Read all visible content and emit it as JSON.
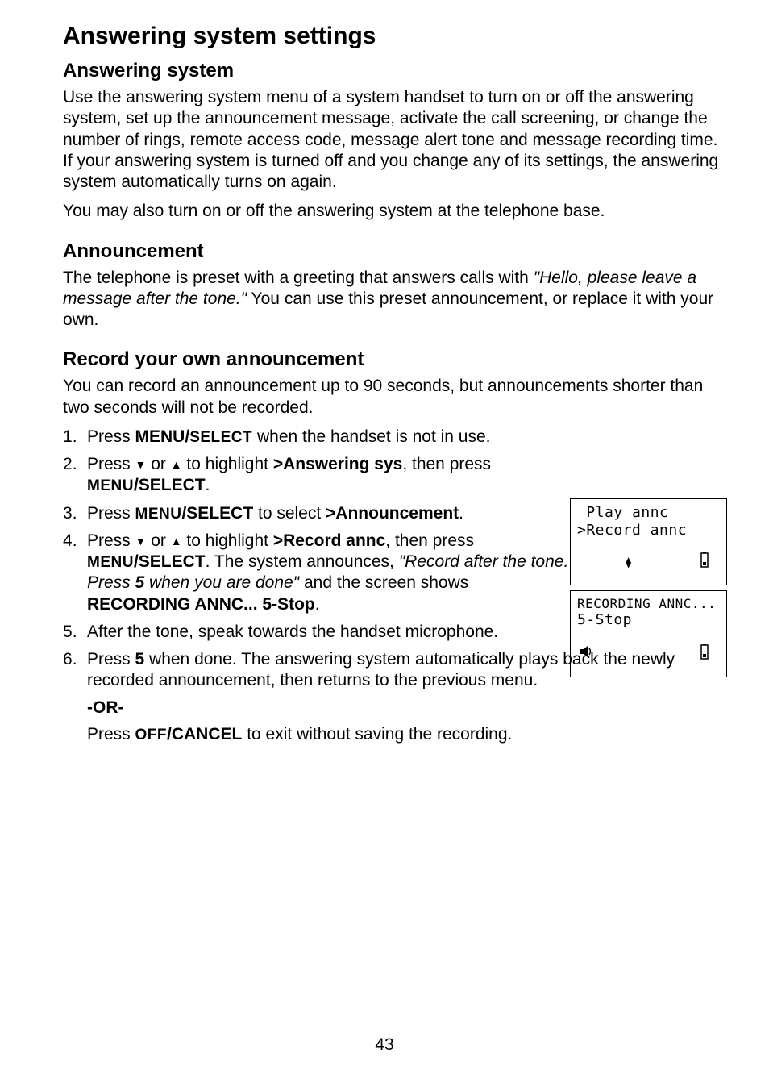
{
  "page_title": "Answering system settings",
  "page_number": "43",
  "section1": {
    "heading": "Answering system",
    "p1": "Use the answering system menu of a system handset to turn on or off the answering system, set up the announcement message, activate the call screening, or change the number of rings, remote access code, message alert tone and message recording time. If your answering system is turned off and you change any of its settings, the answering system automatically turns on again.",
    "p2": "You may also turn on or off the answering system at the telephone base."
  },
  "section2": {
    "heading": "Announcement",
    "pre": "The telephone is preset with a greeting that answers calls with ",
    "ital": "\"Hello, please leave a message after the tone.\"",
    "post": " You can use this preset announcement, or replace it with your own."
  },
  "section3": {
    "heading": "Record your own announcement",
    "intro": "You can record an announcement up to 90 seconds, but announcements shorter than two seconds will not be recorded.",
    "step1_a": "Press ",
    "step1_b": "MENU/",
    "step1_c": "SELECT",
    "step1_d": " when the handset is not in use.",
    "step2_a": "Press ",
    "step2_b": " or ",
    "step2_c": " to highlight ",
    "step2_d": ">Answering sys",
    "step2_e": ", then press ",
    "step2_f": "MENU",
    "step2_g": "/SELECT",
    "step2_h": ".",
    "step3_a": "Press ",
    "step3_b": "MENU",
    "step3_c": "/SELECT",
    "step3_d": " to select ",
    "step3_e": ">Announcement",
    "step3_f": ".",
    "step4_a": "Press ",
    "step4_b": " or ",
    "step4_c": " to highlight ",
    "step4_d": ">Record annc",
    "step4_e": ", then press ",
    "step4_f": "MENU",
    "step4_g": "/SELECT",
    "step4_h": ". The system announces, ",
    "step4_i": "\"Record after the tone. Press ",
    "step4_j": "5",
    "step4_k": " when you are done\"",
    "step4_l": " and the screen shows ",
    "step4_m": "RECORDING ANNC... 5-Stop",
    "step4_n": ".",
    "step5": "After the tone, speak towards the handset microphone.",
    "step6_a": "Press ",
    "step6_b": "5",
    "step6_c": " when done. The answering system automatically plays back the newly recorded announcement, then returns to the previous menu.",
    "or": "-OR-",
    "last_a": "Press ",
    "last_b": "OFF",
    "last_c": "/CANCEL",
    "last_d": " to exit without saving the recording."
  },
  "screen1": {
    "l1": " Play annc",
    "l2": ">Record annc"
  },
  "screen2": {
    "l1": "RECORDING ANNC...",
    "l2": "5-Stop"
  }
}
